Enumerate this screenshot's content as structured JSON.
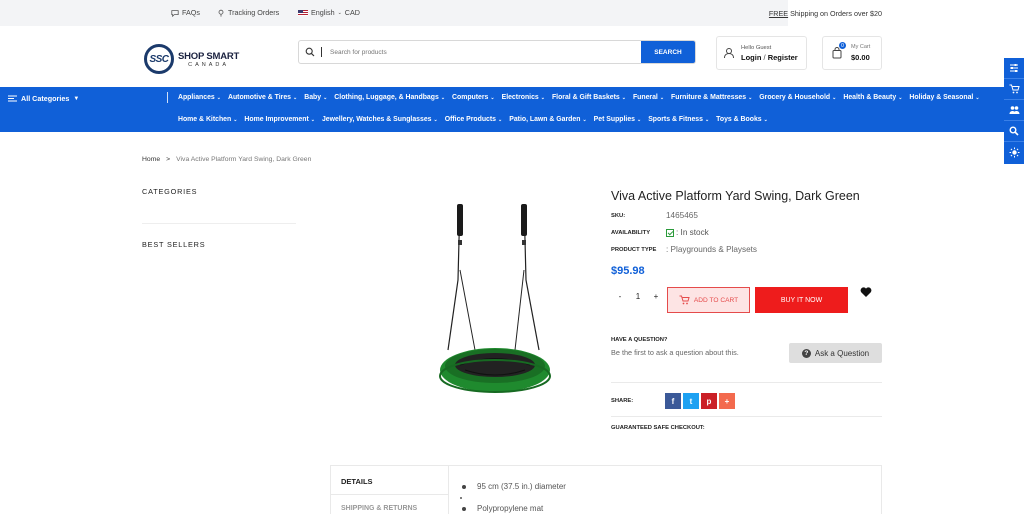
{
  "topbar": {
    "faqs": "FAQs",
    "tracking": "Tracking Orders",
    "language": "English",
    "currency": "CAD",
    "shipping_free": "FREE",
    "shipping_rest": " Shipping on Orders over $20"
  },
  "header": {
    "logo_mark": "SSC",
    "logo_line1": "SHOP SMART",
    "logo_line2": "CANADA",
    "search_placeholder": "Search for products",
    "search_button": "SEARCH",
    "account_greeting": "Hello Guest",
    "login": "Login",
    "separator": "/",
    "register": "Register",
    "cart_count": "0",
    "cart_label": "My Cart",
    "cart_total": "$0.00"
  },
  "nav": {
    "all_categories": "All Categories",
    "row1": [
      "Appliances",
      "Automotive & Tires",
      "Baby",
      "Clothing, Luggage, & Handbags",
      "Computers",
      "Electronics",
      "Floral & Gift Baskets",
      "Funeral",
      "Furniture & Mattresses",
      "Grocery & Household",
      "Health & Beauty",
      "Holiday & Seasonal"
    ],
    "row2": [
      "Home & Kitchen",
      "Home Improvement",
      "Jewellery, Watches & Sunglasses",
      "Office Products",
      "Patio, Lawn & Garden",
      "Pet Supplies",
      "Sports & Fitness",
      "Toys & Books"
    ]
  },
  "breadcrumb": {
    "home": "Home",
    "sep": ">",
    "current": "Viva Active Platform Yard Swing, Dark Green"
  },
  "sidebar": {
    "categories": "CATEGORIES",
    "best_sellers": "BEST SELLERS"
  },
  "product": {
    "title": "Viva Active Platform Yard Swing, Dark Green",
    "sku_label": "SKU:",
    "sku": "1465465",
    "availability_label": "AVAILABILITY",
    "availability": ": In stock",
    "type_label": "PRODUCT TYPE",
    "type": ": Playgrounds & Playsets",
    "price": "$95.98",
    "qty_minus": "-",
    "qty": "1",
    "qty_plus": "+",
    "add_to_cart": "ADD TO CART",
    "buy_now": "BUY IT NOW",
    "question_label": "HAVE A QUESTION?",
    "question_text": "Be the first to ask a question about this.",
    "ask_button": "Ask a Question",
    "share_label": "SHARE:",
    "share": [
      "f",
      "t",
      "p",
      "+"
    ],
    "safe_checkout": "GUARANTEED SAFE CHECKOUT:"
  },
  "tabs": {
    "details": "DETAILS",
    "shipping": "SHIPPING & RETURNS",
    "bullets": [
      "95 cm (37.5 in.) diameter",
      "Polypropylene mat"
    ]
  },
  "colors": {
    "brand_blue": "#1060d8",
    "buy_red": "#ee1c1c",
    "swing_green": "#1f8a2e"
  }
}
